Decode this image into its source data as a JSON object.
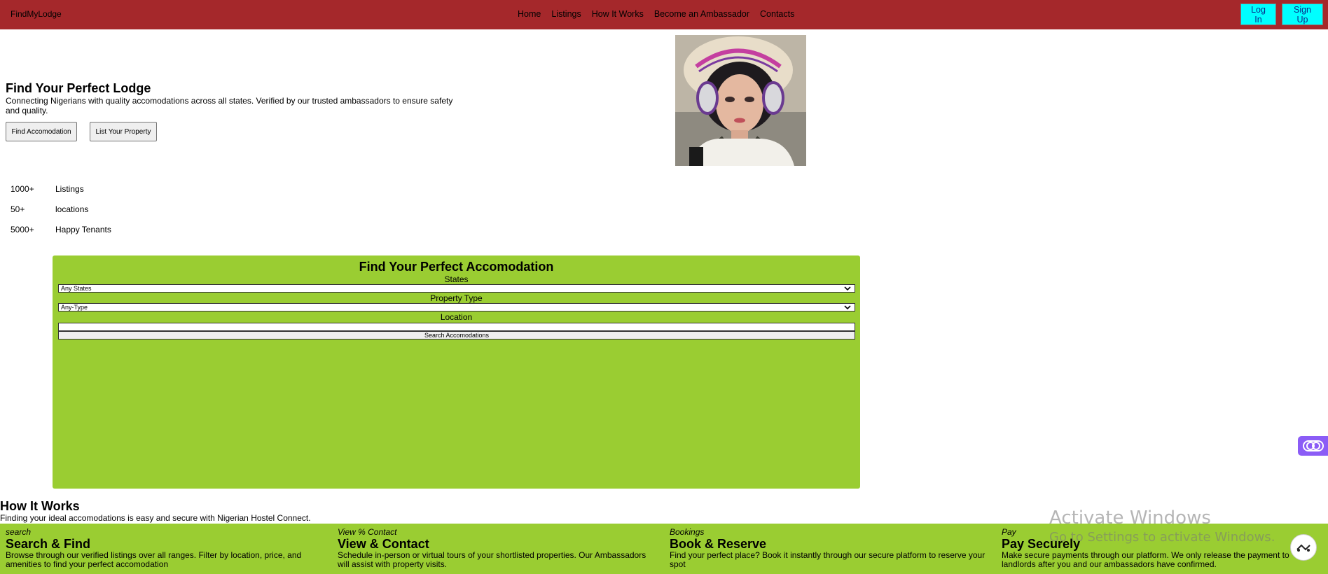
{
  "header": {
    "brand": "FindMyLodge",
    "nav": [
      "Home",
      "Listings",
      "How It Works",
      "Become an Ambassador",
      "Contacts"
    ],
    "login_label": "Log In",
    "signup_label": "Sign Up",
    "bg_color": "#a5282b",
    "button_color": "#00ffff"
  },
  "hero": {
    "title": "Find Your Perfect Lodge",
    "description": "Connecting Nigerians with quality accomodations across all states. Verified by our trusted ambassadors to ensure safety and quality.",
    "find_button": "Find Accomodation",
    "list_button": "List Your Property",
    "image_icon": "portrait-image"
  },
  "stats": [
    {
      "value": "1000+",
      "label": "Listings"
    },
    {
      "value": "50+",
      "label": "locations"
    },
    {
      "value": "5000+",
      "label": "Happy Tenants"
    }
  ],
  "search": {
    "title": "Find Your Perfect Accomodation",
    "states_label": "States",
    "states_value": "Any States",
    "type_label": "Property Type",
    "type_value": "Any-Type",
    "location_label": "Location",
    "location_value": "",
    "submit_label": "Search Accomodations",
    "panel_color": "#9acd32"
  },
  "how_it_works": {
    "title": "How It Works",
    "description": "Finding your ideal accomodations is easy and secure with Nigerian Hostel Connect.",
    "steps": [
      {
        "kicker": "search",
        "title": "Search & Find",
        "desc": "Browse through our verified listings over all ranges. Filter by location, price, and amenities to find your perfect accomodation"
      },
      {
        "kicker": "View % Contact",
        "title": "View & Contact",
        "desc": "Schedule in-person or virtual tours of your shortlisted properties. Our Ambassadors will assist with property visits."
      },
      {
        "kicker": "Bookings",
        "title": "Book & Reserve",
        "desc": "Find your perfect place? Book it instantly through our secure platform to reserve your spot"
      },
      {
        "kicker": "Pay",
        "title": "Pay Securely",
        "desc": "Make secure payments through our platform. We only release the payment to landlords after you and our ambassadors have confirmed."
      }
    ]
  },
  "system": {
    "activate_title": "Activate Windows",
    "activate_sub": "Go to Settings to activate Windows."
  }
}
